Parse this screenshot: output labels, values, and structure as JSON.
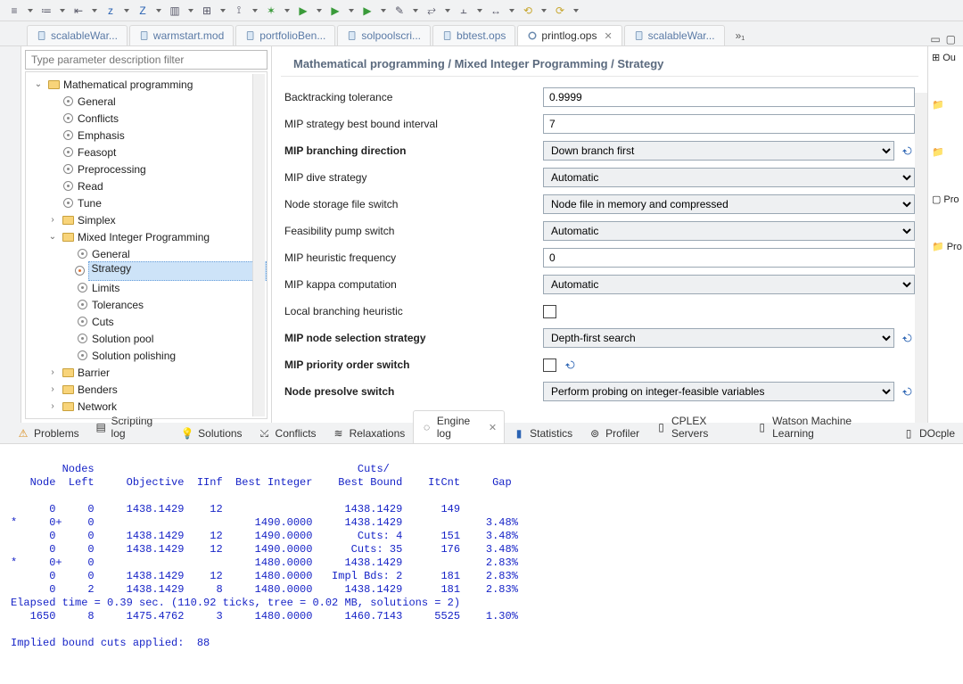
{
  "toolbar": {
    "items": [
      "align",
      "list",
      "outdent",
      "z1",
      "z2",
      "box",
      "grid",
      "ruler",
      "bug-run",
      "play",
      "play-frame",
      "play-dot",
      "wand",
      "match",
      "chart",
      "swap",
      "undo-arrow",
      "redo-arrow"
    ]
  },
  "tabs": [
    {
      "label": "scalableWar...",
      "active": false,
      "kind": "blue"
    },
    {
      "label": "warmstart.mod",
      "active": false,
      "kind": "blue"
    },
    {
      "label": "portfolioBen...",
      "active": false,
      "kind": "blue"
    },
    {
      "label": "solpoolscri...",
      "active": false,
      "kind": "blue"
    },
    {
      "label": "bbtest.ops",
      "active": false,
      "kind": "blue"
    },
    {
      "label": "printlog.ops",
      "active": true,
      "kind": "settings"
    },
    {
      "label": "scalableWar...",
      "active": false,
      "kind": "blue"
    }
  ],
  "overflowLabel": "»₁",
  "filterPlaceholder": "Type parameter description filter",
  "tree": [
    {
      "d": 0,
      "t": "open",
      "i": "folder",
      "l": "Mathematical programming"
    },
    {
      "d": 1,
      "t": "none",
      "i": "gear",
      "l": "General"
    },
    {
      "d": 1,
      "t": "none",
      "i": "gear",
      "l": "Conflicts"
    },
    {
      "d": 1,
      "t": "none",
      "i": "gear",
      "l": "Emphasis"
    },
    {
      "d": 1,
      "t": "none",
      "i": "gear",
      "l": "Feasopt"
    },
    {
      "d": 1,
      "t": "none",
      "i": "gear",
      "l": "Preprocessing"
    },
    {
      "d": 1,
      "t": "none",
      "i": "gear",
      "l": "Read"
    },
    {
      "d": 1,
      "t": "none",
      "i": "gear",
      "l": "Tune"
    },
    {
      "d": 1,
      "t": "closed",
      "i": "folder",
      "l": "Simplex"
    },
    {
      "d": 1,
      "t": "open",
      "i": "folder",
      "l": "Mixed Integer Programming"
    },
    {
      "d": 2,
      "t": "none",
      "i": "gear",
      "l": "General"
    },
    {
      "d": 2,
      "t": "none",
      "i": "gearm",
      "l": "Strategy",
      "sel": true
    },
    {
      "d": 2,
      "t": "none",
      "i": "gear",
      "l": "Limits"
    },
    {
      "d": 2,
      "t": "none",
      "i": "gear",
      "l": "Tolerances"
    },
    {
      "d": 2,
      "t": "none",
      "i": "gear",
      "l": "Cuts"
    },
    {
      "d": 2,
      "t": "none",
      "i": "gear",
      "l": "Solution pool"
    },
    {
      "d": 2,
      "t": "none",
      "i": "gear",
      "l": "Solution polishing"
    },
    {
      "d": 1,
      "t": "closed",
      "i": "folder",
      "l": "Barrier"
    },
    {
      "d": 1,
      "t": "closed",
      "i": "folder",
      "l": "Benders"
    },
    {
      "d": 1,
      "t": "closed",
      "i": "folder",
      "l": "Network"
    }
  ],
  "settings": {
    "title": "Mathematical programming / Mixed Integer Programming / Strategy",
    "rows": [
      {
        "label": "Backtracking tolerance",
        "type": "text",
        "value": "0.9999",
        "bold": false
      },
      {
        "label": "MIP strategy best bound interval",
        "type": "text",
        "value": "7",
        "bold": false
      },
      {
        "label": "MIP branching direction",
        "type": "select",
        "value": "Down branch first",
        "bold": true,
        "revert": true
      },
      {
        "label": "MIP dive strategy",
        "type": "select",
        "value": "Automatic",
        "bold": false
      },
      {
        "label": "Node storage file switch",
        "type": "select",
        "value": "Node file in memory and compressed",
        "bold": false
      },
      {
        "label": "Feasibility pump switch",
        "type": "select",
        "value": "Automatic",
        "bold": false
      },
      {
        "label": "MIP heuristic frequency",
        "type": "text",
        "value": "0",
        "bold": false
      },
      {
        "label": "MIP kappa computation",
        "type": "select",
        "value": "Automatic",
        "bold": false
      },
      {
        "label": "Local branching heuristic",
        "type": "check",
        "value": "",
        "bold": false
      },
      {
        "label": "MIP node selection strategy",
        "type": "select",
        "value": "Depth-first search",
        "bold": true,
        "revert": true
      },
      {
        "label": "MIP priority order switch",
        "type": "check",
        "value": "",
        "bold": true,
        "revert": true
      },
      {
        "label": "Node presolve switch",
        "type": "select",
        "value": "Perform probing on integer-feasible variables",
        "bold": true,
        "revert": true
      }
    ]
  },
  "right": {
    "items": [
      "Ou",
      "",
      "",
      "Pro",
      "Pro..."
    ]
  },
  "btabs": [
    {
      "l": "Problems",
      "k": "warn"
    },
    {
      "l": "Scripting log",
      "k": "script"
    },
    {
      "l": "Solutions",
      "k": "sol"
    },
    {
      "l": "Conflicts",
      "k": "conf"
    },
    {
      "l": "Relaxations",
      "k": "relax"
    },
    {
      "l": "Engine log",
      "k": "engine",
      "active": true
    },
    {
      "l": "Statistics",
      "k": "stats"
    },
    {
      "l": "Profiler",
      "k": "prof"
    },
    {
      "l": "CPLEX Servers",
      "k": "srv"
    },
    {
      "l": "Watson Machine Learning",
      "k": "wml"
    },
    {
      "l": "DOcple",
      "k": "doc"
    }
  ],
  "log": {
    "header1": "        Nodes                                         Cuts/",
    "header2": "   Node  Left     Objective  IInf  Best Integer    Best Bound    ItCnt     Gap",
    "rows": [
      "      0     0     1438.1429    12                   1438.1429      149         ",
      "*     0+    0                         1490.0000     1438.1429             3.48%",
      "      0     0     1438.1429    12     1490.0000       Cuts: 4      151    3.48%",
      "      0     0     1438.1429    12     1490.0000      Cuts: 35      176    3.48%",
      "*     0+    0                         1480.0000     1438.1429             2.83%",
      "      0     0     1438.1429    12     1480.0000   Impl Bds: 2      181    2.83%",
      "      0     2     1438.1429     8     1480.0000     1438.1429      181    2.83%"
    ],
    "elapsed": "Elapsed time = 0.39 sec. (110.92 ticks, tree = 0.02 MB, solutions = 2)",
    "final": "   1650     8     1475.4762     3     1480.0000     1460.7143     5525    1.30%",
    "footer": "Implied bound cuts applied:  88"
  }
}
